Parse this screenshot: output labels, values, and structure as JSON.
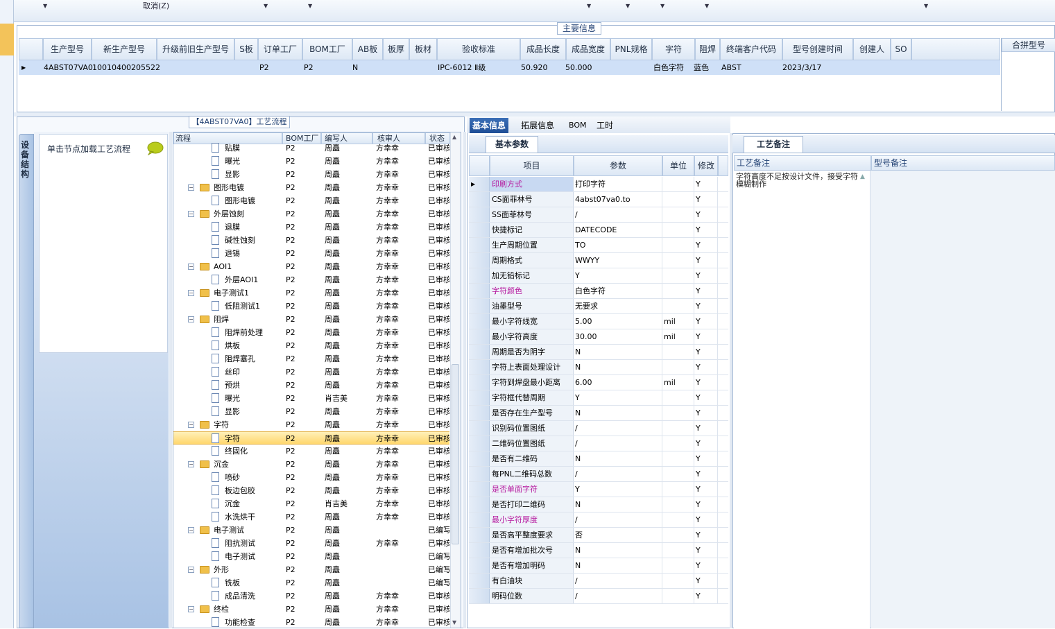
{
  "toolbar": {
    "cancel_label": "取消(Z)"
  },
  "main_group": {
    "legend": "主要信息",
    "columns": [
      "生产型号",
      "新生产型号",
      "升级前旧生产型号",
      "S板",
      "订单工厂",
      "BOM工厂",
      "AB板",
      "板厚",
      "板材",
      "验收标准",
      "成品长度",
      "成品宽度",
      "PNL规格",
      "字符",
      "阻焊",
      "终端客户代码",
      "型号创建时间",
      "创建人",
      "SO"
    ],
    "row": {
      "prod_model": "4ABST07VA0",
      "new_model": "10010400205522",
      "order_factory": "P2",
      "bom_factory": "P2",
      "ab": "N",
      "standard": "IPC-6012 Ⅱ级",
      "length": "50.920",
      "width": "50.000",
      "char": "白色字符",
      "mask": "蓝色",
      "customer": "ABST",
      "created": "2023/3/17"
    },
    "merge_header": "合拼型号"
  },
  "left_panel": {
    "flow_title": "【4ABST07VA0】工艺流程",
    "vtab": "设备结构",
    "node_hint": "单击节点加载工艺流程",
    "tree_headers": [
      "流程",
      "BOM工厂",
      "编写人",
      "核审人",
      "状态"
    ],
    "rows": [
      {
        "name": "贴膜",
        "type": "doc",
        "level": 2,
        "bom": "P2",
        "writer": "周矗",
        "reviewer": "方幸幸",
        "status": "已审核"
      },
      {
        "name": "曝光",
        "type": "doc",
        "level": 2,
        "bom": "P2",
        "writer": "周矗",
        "reviewer": "方幸幸",
        "status": "已审核"
      },
      {
        "name": "显影",
        "type": "doc",
        "level": 2,
        "bom": "P2",
        "writer": "周矗",
        "reviewer": "方幸幸",
        "status": "已审核"
      },
      {
        "name": "图形电镀",
        "type": "folder",
        "level": 1,
        "bom": "P2",
        "writer": "周矗",
        "reviewer": "方幸幸",
        "status": "已审核"
      },
      {
        "name": "图形电镀",
        "type": "doc",
        "level": 2,
        "bom": "P2",
        "writer": "周矗",
        "reviewer": "方幸幸",
        "status": "已审核"
      },
      {
        "name": "外层蚀刻",
        "type": "folder",
        "level": 1,
        "bom": "P2",
        "writer": "周矗",
        "reviewer": "方幸幸",
        "status": "已审核"
      },
      {
        "name": "退膜",
        "type": "doc",
        "level": 2,
        "bom": "P2",
        "writer": "周矗",
        "reviewer": "方幸幸",
        "status": "已审核"
      },
      {
        "name": "碱性蚀刻",
        "type": "doc",
        "level": 2,
        "bom": "P2",
        "writer": "周矗",
        "reviewer": "方幸幸",
        "status": "已审核"
      },
      {
        "name": "退锡",
        "type": "doc",
        "level": 2,
        "bom": "P2",
        "writer": "周矗",
        "reviewer": "方幸幸",
        "status": "已审核"
      },
      {
        "name": "AOI1",
        "type": "folder",
        "level": 1,
        "bom": "P2",
        "writer": "周矗",
        "reviewer": "方幸幸",
        "status": "已审核"
      },
      {
        "name": "外层AOI1",
        "type": "doc",
        "level": 2,
        "bom": "P2",
        "writer": "周矗",
        "reviewer": "方幸幸",
        "status": "已审核"
      },
      {
        "name": "电子测试1",
        "type": "folder",
        "level": 1,
        "bom": "P2",
        "writer": "周矗",
        "reviewer": "方幸幸",
        "status": "已审核"
      },
      {
        "name": "低阻测试1",
        "type": "doc",
        "level": 2,
        "bom": "P2",
        "writer": "周矗",
        "reviewer": "方幸幸",
        "status": "已审核"
      },
      {
        "name": "阻焊",
        "type": "folder",
        "level": 1,
        "bom": "P2",
        "writer": "周矗",
        "reviewer": "方幸幸",
        "status": "已审核"
      },
      {
        "name": "阻焊前处理",
        "type": "doc",
        "level": 2,
        "bom": "P2",
        "writer": "周矗",
        "reviewer": "方幸幸",
        "status": "已审核"
      },
      {
        "name": "烘板",
        "type": "doc",
        "level": 2,
        "bom": "P2",
        "writer": "周矗",
        "reviewer": "方幸幸",
        "status": "已审核"
      },
      {
        "name": "阻焊塞孔",
        "type": "doc",
        "level": 2,
        "bom": "P2",
        "writer": "周矗",
        "reviewer": "方幸幸",
        "status": "已审核"
      },
      {
        "name": "丝印",
        "type": "doc",
        "level": 2,
        "bom": "P2",
        "writer": "周矗",
        "reviewer": "方幸幸",
        "status": "已审核"
      },
      {
        "name": "预烘",
        "type": "doc",
        "level": 2,
        "bom": "P2",
        "writer": "周矗",
        "reviewer": "方幸幸",
        "status": "已审核"
      },
      {
        "name": "曝光",
        "type": "doc",
        "level": 2,
        "bom": "P2",
        "writer": "肖吉美",
        "reviewer": "方幸幸",
        "status": "已审核"
      },
      {
        "name": "显影",
        "type": "doc",
        "level": 2,
        "bom": "P2",
        "writer": "周矗",
        "reviewer": "方幸幸",
        "status": "已审核"
      },
      {
        "name": "字符",
        "type": "folder",
        "level": 1,
        "bom": "P2",
        "writer": "周矗",
        "reviewer": "方幸幸",
        "status": "已审核"
      },
      {
        "name": "字符",
        "type": "doc",
        "level": 2,
        "bom": "P2",
        "writer": "周矗",
        "reviewer": "方幸幸",
        "status": "已审核",
        "selected": true
      },
      {
        "name": "终固化",
        "type": "doc",
        "level": 2,
        "bom": "P2",
        "writer": "周矗",
        "reviewer": "方幸幸",
        "status": "已审核"
      },
      {
        "name": "沉金",
        "type": "folder",
        "level": 1,
        "bom": "P2",
        "writer": "周矗",
        "reviewer": "方幸幸",
        "status": "已审核"
      },
      {
        "name": "喷砂",
        "type": "doc",
        "level": 2,
        "bom": "P2",
        "writer": "周矗",
        "reviewer": "方幸幸",
        "status": "已审核"
      },
      {
        "name": "板边包胶",
        "type": "doc",
        "level": 2,
        "bom": "P2",
        "writer": "周矗",
        "reviewer": "方幸幸",
        "status": "已审核"
      },
      {
        "name": "沉金",
        "type": "doc",
        "level": 2,
        "bom": "P2",
        "writer": "肖吉美",
        "reviewer": "方幸幸",
        "status": "已审核"
      },
      {
        "name": "水洗烘干",
        "type": "doc",
        "level": 2,
        "bom": "P2",
        "writer": "周矗",
        "reviewer": "方幸幸",
        "status": "已审核"
      },
      {
        "name": "电子测试",
        "type": "folder",
        "level": 1,
        "bom": "P2",
        "writer": "周矗",
        "reviewer": "",
        "status": "已编写"
      },
      {
        "name": "阻抗测试",
        "type": "doc",
        "level": 2,
        "bom": "P2",
        "writer": "周矗",
        "reviewer": "方幸幸",
        "status": "已审核"
      },
      {
        "name": "电子测试",
        "type": "doc",
        "level": 2,
        "bom": "P2",
        "writer": "周矗",
        "reviewer": "",
        "status": "已编写"
      },
      {
        "name": "外形",
        "type": "folder",
        "level": 1,
        "bom": "P2",
        "writer": "周矗",
        "reviewer": "",
        "status": "已编写"
      },
      {
        "name": "铣板",
        "type": "doc",
        "level": 2,
        "bom": "P2",
        "writer": "周矗",
        "reviewer": "",
        "status": "已编写"
      },
      {
        "name": "成品清洗",
        "type": "doc",
        "level": 2,
        "bom": "P2",
        "writer": "周矗",
        "reviewer": "方幸幸",
        "status": "已审核"
      },
      {
        "name": "终检",
        "type": "folder",
        "level": 1,
        "bom": "P2",
        "writer": "周矗",
        "reviewer": "方幸幸",
        "status": "已审核"
      },
      {
        "name": "功能检查",
        "type": "doc",
        "level": 2,
        "bom": "P2",
        "writer": "周矗",
        "reviewer": "方幸幸",
        "status": "已审核"
      }
    ]
  },
  "mid_panel": {
    "tabs": [
      "基本信息",
      "拓展信息",
      "BOM",
      "工时"
    ],
    "sub_tab": "基本参数",
    "headers": [
      "项目",
      "参数",
      "单位",
      "修改"
    ],
    "rows": [
      {
        "item": "印刷方式",
        "value": "打印字符",
        "unit": "",
        "mod": "Y",
        "hl": true
      },
      {
        "item": "CS面菲林号",
        "value": "4abst07va0.to",
        "unit": "",
        "mod": "Y"
      },
      {
        "item": "SS面菲林号",
        "value": "/",
        "unit": "",
        "mod": "Y"
      },
      {
        "item": "快捷标记",
        "value": "DATECODE",
        "unit": "",
        "mod": "Y"
      },
      {
        "item": "生产周期位置",
        "value": "TO",
        "unit": "",
        "mod": "Y"
      },
      {
        "item": "周期格式",
        "value": "WWYY",
        "unit": "",
        "mod": "Y"
      },
      {
        "item": "加无铅标记",
        "value": "Y",
        "unit": "",
        "mod": "Y"
      },
      {
        "item": "字符颜色",
        "value": "白色字符",
        "unit": "",
        "mod": "Y",
        "hl": true
      },
      {
        "item": "油墨型号",
        "value": "无要求",
        "unit": "",
        "mod": "Y"
      },
      {
        "item": "最小字符线宽",
        "value": "5.00",
        "unit": "mil",
        "mod": "Y"
      },
      {
        "item": "最小字符高度",
        "value": "30.00",
        "unit": "mil",
        "mod": "Y"
      },
      {
        "item": "周期是否为阴字",
        "value": "N",
        "unit": "",
        "mod": "Y"
      },
      {
        "item": "字符上表面处理设计",
        "value": "N",
        "unit": "",
        "mod": "Y"
      },
      {
        "item": "字符到焊盘最小距离",
        "value": "6.00",
        "unit": "mil",
        "mod": "Y"
      },
      {
        "item": "字符框代替周期",
        "value": "Y",
        "unit": "",
        "mod": "Y"
      },
      {
        "item": "是否存在生产型号",
        "value": "N",
        "unit": "",
        "mod": "Y"
      },
      {
        "item": "识别码位置图纸",
        "value": "/",
        "unit": "",
        "mod": "Y"
      },
      {
        "item": "二维码位置图纸",
        "value": "/",
        "unit": "",
        "mod": "Y"
      },
      {
        "item": "是否有二维码",
        "value": "N",
        "unit": "",
        "mod": "Y"
      },
      {
        "item": "每PNL二维码总数",
        "value": "/",
        "unit": "",
        "mod": "Y"
      },
      {
        "item": "是否单面字符",
        "value": "Y",
        "unit": "",
        "mod": "Y",
        "hl": true
      },
      {
        "item": "是否打印二维码",
        "value": "N",
        "unit": "",
        "mod": "Y"
      },
      {
        "item": "最小字符厚度",
        "value": "/",
        "unit": "",
        "mod": "Y",
        "hl": true
      },
      {
        "item": "是否高平整度要求",
        "value": "否",
        "unit": "",
        "mod": "Y"
      },
      {
        "item": "是否有增加批次号",
        "value": "N",
        "unit": "",
        "mod": "Y"
      },
      {
        "item": "是否有增加明码",
        "value": "N",
        "unit": "",
        "mod": "Y"
      },
      {
        "item": "有白油块",
        "value": "/",
        "unit": "",
        "mod": "Y"
      },
      {
        "item": "明码位数",
        "value": "/",
        "unit": "",
        "mod": "Y"
      }
    ]
  },
  "right_panel": {
    "tab": "工艺备注",
    "col1": "工艺备注",
    "col2": "型号备注",
    "note": "字符高度不足按设计文件，接受字符模糊制作"
  }
}
